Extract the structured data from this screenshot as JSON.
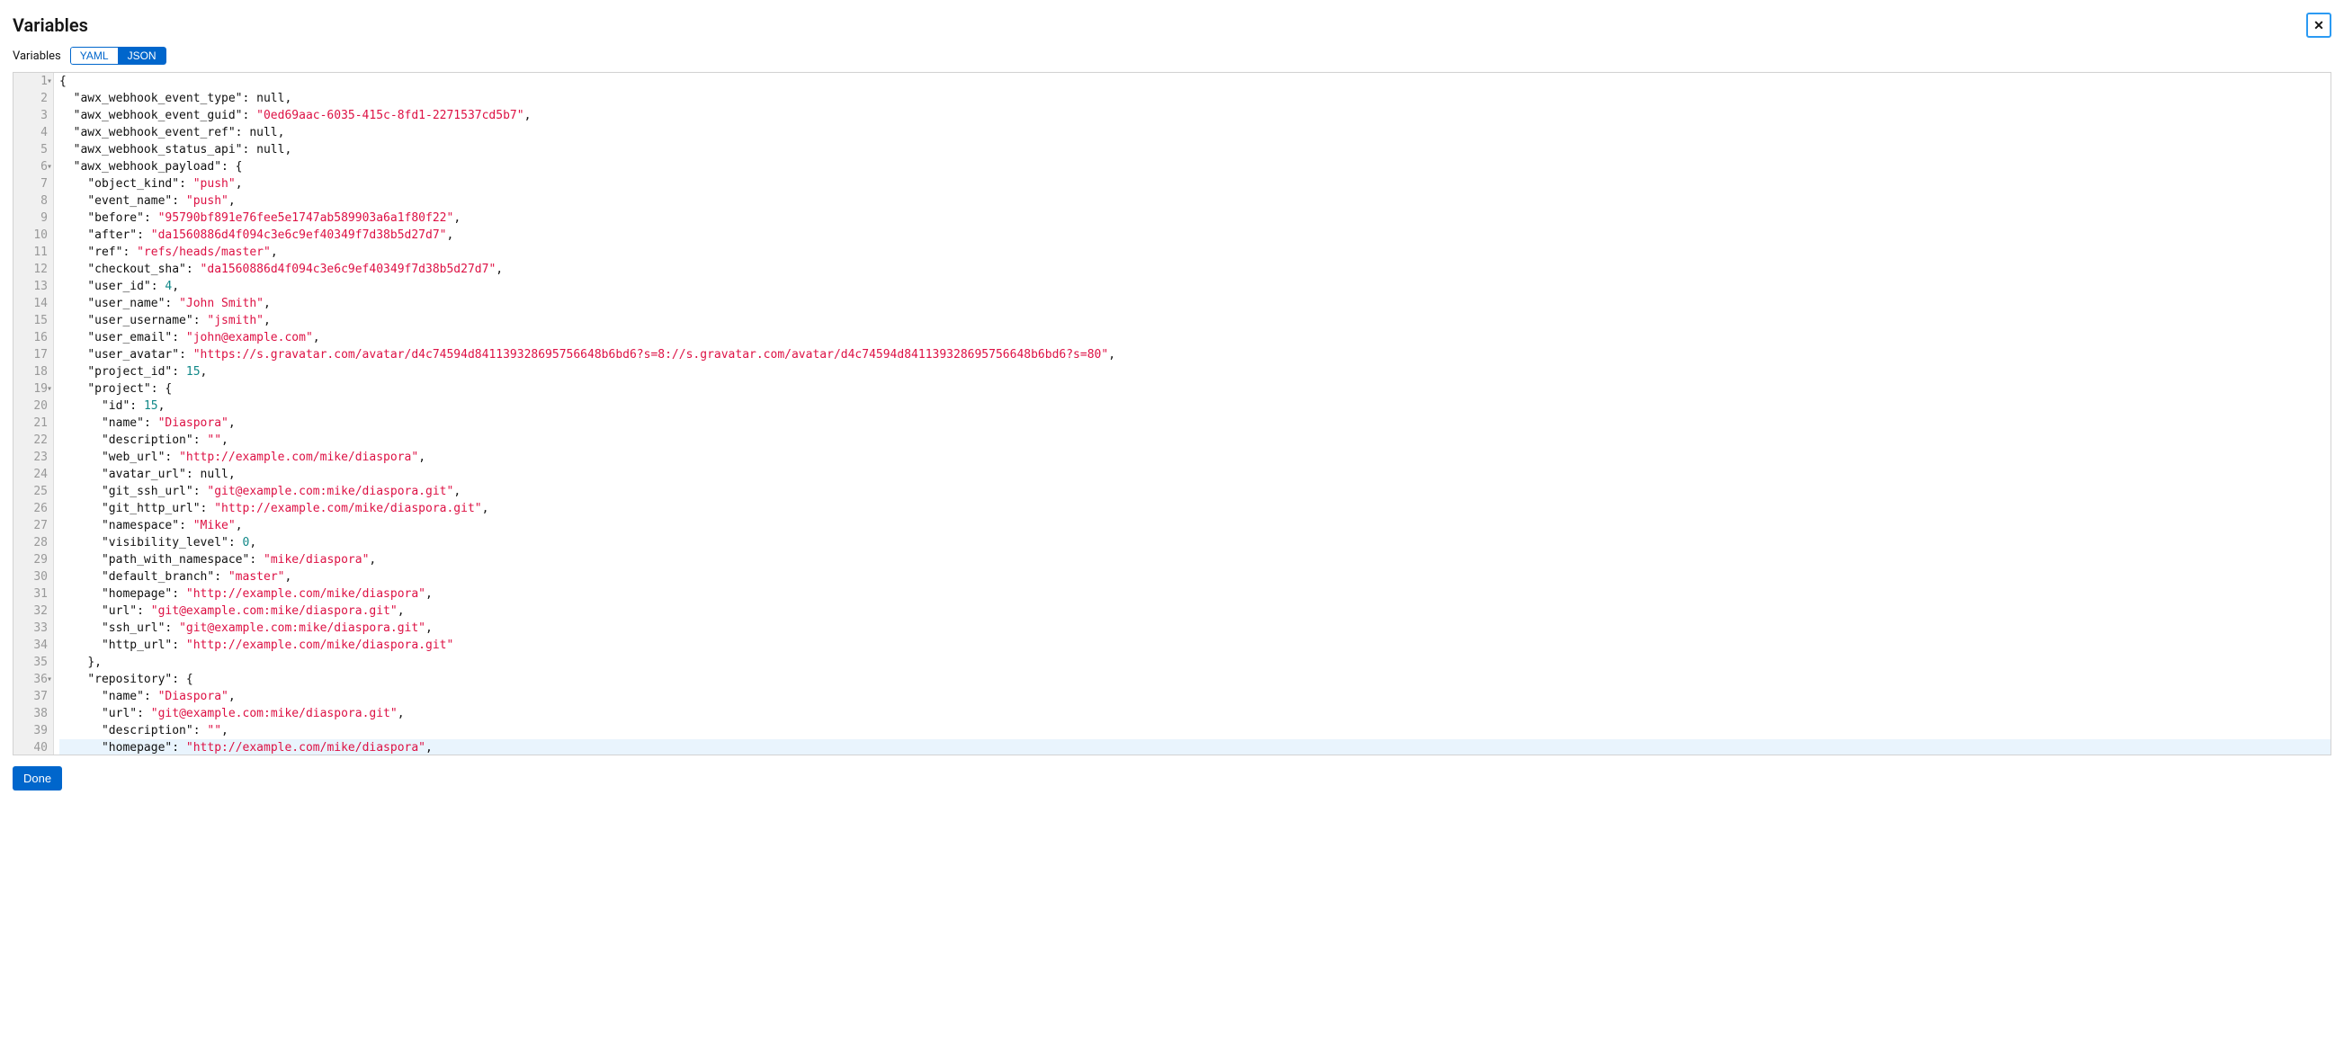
{
  "header": {
    "title": "Variables",
    "close_symbol": "✕"
  },
  "controls": {
    "label": "Variables",
    "toggle": {
      "yaml": "YAML",
      "json": "JSON"
    }
  },
  "footer": {
    "done": "Done"
  },
  "fold_lines": [
    1,
    6,
    19,
    36
  ],
  "code_lines": [
    [
      {
        "t": "punct",
        "v": "{"
      }
    ],
    [
      {
        "t": "ind",
        "v": "  "
      },
      {
        "t": "key",
        "v": "\"awx_webhook_event_type\""
      },
      {
        "t": "punct",
        "v": ": "
      },
      {
        "t": "null",
        "v": "null"
      },
      {
        "t": "punct",
        "v": ","
      }
    ],
    [
      {
        "t": "ind",
        "v": "  "
      },
      {
        "t": "key",
        "v": "\"awx_webhook_event_guid\""
      },
      {
        "t": "punct",
        "v": ": "
      },
      {
        "t": "str",
        "v": "\"0ed69aac-6035-415c-8fd1-2271537cd5b7\""
      },
      {
        "t": "punct",
        "v": ","
      }
    ],
    [
      {
        "t": "ind",
        "v": "  "
      },
      {
        "t": "key",
        "v": "\"awx_webhook_event_ref\""
      },
      {
        "t": "punct",
        "v": ": "
      },
      {
        "t": "null",
        "v": "null"
      },
      {
        "t": "punct",
        "v": ","
      }
    ],
    [
      {
        "t": "ind",
        "v": "  "
      },
      {
        "t": "key",
        "v": "\"awx_webhook_status_api\""
      },
      {
        "t": "punct",
        "v": ": "
      },
      {
        "t": "null",
        "v": "null"
      },
      {
        "t": "punct",
        "v": ","
      }
    ],
    [
      {
        "t": "ind",
        "v": "  "
      },
      {
        "t": "key",
        "v": "\"awx_webhook_payload\""
      },
      {
        "t": "punct",
        "v": ": {"
      }
    ],
    [
      {
        "t": "ind",
        "v": "    "
      },
      {
        "t": "key",
        "v": "\"object_kind\""
      },
      {
        "t": "punct",
        "v": ": "
      },
      {
        "t": "str",
        "v": "\"push\""
      },
      {
        "t": "punct",
        "v": ","
      }
    ],
    [
      {
        "t": "ind",
        "v": "    "
      },
      {
        "t": "key",
        "v": "\"event_name\""
      },
      {
        "t": "punct",
        "v": ": "
      },
      {
        "t": "str",
        "v": "\"push\""
      },
      {
        "t": "punct",
        "v": ","
      }
    ],
    [
      {
        "t": "ind",
        "v": "    "
      },
      {
        "t": "key",
        "v": "\"before\""
      },
      {
        "t": "punct",
        "v": ": "
      },
      {
        "t": "str",
        "v": "\"95790bf891e76fee5e1747ab589903a6a1f80f22\""
      },
      {
        "t": "punct",
        "v": ","
      }
    ],
    [
      {
        "t": "ind",
        "v": "    "
      },
      {
        "t": "key",
        "v": "\"after\""
      },
      {
        "t": "punct",
        "v": ": "
      },
      {
        "t": "str",
        "v": "\"da1560886d4f094c3e6c9ef40349f7d38b5d27d7\""
      },
      {
        "t": "punct",
        "v": ","
      }
    ],
    [
      {
        "t": "ind",
        "v": "    "
      },
      {
        "t": "key",
        "v": "\"ref\""
      },
      {
        "t": "punct",
        "v": ": "
      },
      {
        "t": "str",
        "v": "\"refs/heads/master\""
      },
      {
        "t": "punct",
        "v": ","
      }
    ],
    [
      {
        "t": "ind",
        "v": "    "
      },
      {
        "t": "key",
        "v": "\"checkout_sha\""
      },
      {
        "t": "punct",
        "v": ": "
      },
      {
        "t": "str",
        "v": "\"da1560886d4f094c3e6c9ef40349f7d38b5d27d7\""
      },
      {
        "t": "punct",
        "v": ","
      }
    ],
    [
      {
        "t": "ind",
        "v": "    "
      },
      {
        "t": "key",
        "v": "\"user_id\""
      },
      {
        "t": "punct",
        "v": ": "
      },
      {
        "t": "num",
        "v": "4"
      },
      {
        "t": "punct",
        "v": ","
      }
    ],
    [
      {
        "t": "ind",
        "v": "    "
      },
      {
        "t": "key",
        "v": "\"user_name\""
      },
      {
        "t": "punct",
        "v": ": "
      },
      {
        "t": "str",
        "v": "\"John Smith\""
      },
      {
        "t": "punct",
        "v": ","
      }
    ],
    [
      {
        "t": "ind",
        "v": "    "
      },
      {
        "t": "key",
        "v": "\"user_username\""
      },
      {
        "t": "punct",
        "v": ": "
      },
      {
        "t": "str",
        "v": "\"jsmith\""
      },
      {
        "t": "punct",
        "v": ","
      }
    ],
    [
      {
        "t": "ind",
        "v": "    "
      },
      {
        "t": "key",
        "v": "\"user_email\""
      },
      {
        "t": "punct",
        "v": ": "
      },
      {
        "t": "str",
        "v": "\"john@example.com\""
      },
      {
        "t": "punct",
        "v": ","
      }
    ],
    [
      {
        "t": "ind",
        "v": "    "
      },
      {
        "t": "key",
        "v": "\"user_avatar\""
      },
      {
        "t": "punct",
        "v": ": "
      },
      {
        "t": "str",
        "v": "\"https://s.gravatar.com/avatar/d4c74594d841139328695756648b6bd6?s=8://s.gravatar.com/avatar/d4c74594d841139328695756648b6bd6?s=80\""
      },
      {
        "t": "punct",
        "v": ","
      }
    ],
    [
      {
        "t": "ind",
        "v": "    "
      },
      {
        "t": "key",
        "v": "\"project_id\""
      },
      {
        "t": "punct",
        "v": ": "
      },
      {
        "t": "num",
        "v": "15"
      },
      {
        "t": "punct",
        "v": ","
      }
    ],
    [
      {
        "t": "ind",
        "v": "    "
      },
      {
        "t": "key",
        "v": "\"project\""
      },
      {
        "t": "punct",
        "v": ": {"
      }
    ],
    [
      {
        "t": "ind",
        "v": "      "
      },
      {
        "t": "key",
        "v": "\"id\""
      },
      {
        "t": "punct",
        "v": ": "
      },
      {
        "t": "num",
        "v": "15"
      },
      {
        "t": "punct",
        "v": ","
      }
    ],
    [
      {
        "t": "ind",
        "v": "      "
      },
      {
        "t": "key",
        "v": "\"name\""
      },
      {
        "t": "punct",
        "v": ": "
      },
      {
        "t": "str",
        "v": "\"Diaspora\""
      },
      {
        "t": "punct",
        "v": ","
      }
    ],
    [
      {
        "t": "ind",
        "v": "      "
      },
      {
        "t": "key",
        "v": "\"description\""
      },
      {
        "t": "punct",
        "v": ": "
      },
      {
        "t": "str",
        "v": "\"\""
      },
      {
        "t": "punct",
        "v": ","
      }
    ],
    [
      {
        "t": "ind",
        "v": "      "
      },
      {
        "t": "key",
        "v": "\"web_url\""
      },
      {
        "t": "punct",
        "v": ": "
      },
      {
        "t": "str",
        "v": "\"http://example.com/mike/diaspora\""
      },
      {
        "t": "punct",
        "v": ","
      }
    ],
    [
      {
        "t": "ind",
        "v": "      "
      },
      {
        "t": "key",
        "v": "\"avatar_url\""
      },
      {
        "t": "punct",
        "v": ": "
      },
      {
        "t": "null",
        "v": "null"
      },
      {
        "t": "punct",
        "v": ","
      }
    ],
    [
      {
        "t": "ind",
        "v": "      "
      },
      {
        "t": "key",
        "v": "\"git_ssh_url\""
      },
      {
        "t": "punct",
        "v": ": "
      },
      {
        "t": "str",
        "v": "\"git@example.com:mike/diaspora.git\""
      },
      {
        "t": "punct",
        "v": ","
      }
    ],
    [
      {
        "t": "ind",
        "v": "      "
      },
      {
        "t": "key",
        "v": "\"git_http_url\""
      },
      {
        "t": "punct",
        "v": ": "
      },
      {
        "t": "str",
        "v": "\"http://example.com/mike/diaspora.git\""
      },
      {
        "t": "punct",
        "v": ","
      }
    ],
    [
      {
        "t": "ind",
        "v": "      "
      },
      {
        "t": "key",
        "v": "\"namespace\""
      },
      {
        "t": "punct",
        "v": ": "
      },
      {
        "t": "str",
        "v": "\"Mike\""
      },
      {
        "t": "punct",
        "v": ","
      }
    ],
    [
      {
        "t": "ind",
        "v": "      "
      },
      {
        "t": "key",
        "v": "\"visibility_level\""
      },
      {
        "t": "punct",
        "v": ": "
      },
      {
        "t": "num",
        "v": "0"
      },
      {
        "t": "punct",
        "v": ","
      }
    ],
    [
      {
        "t": "ind",
        "v": "      "
      },
      {
        "t": "key",
        "v": "\"path_with_namespace\""
      },
      {
        "t": "punct",
        "v": ": "
      },
      {
        "t": "str",
        "v": "\"mike/diaspora\""
      },
      {
        "t": "punct",
        "v": ","
      }
    ],
    [
      {
        "t": "ind",
        "v": "      "
      },
      {
        "t": "key",
        "v": "\"default_branch\""
      },
      {
        "t": "punct",
        "v": ": "
      },
      {
        "t": "str",
        "v": "\"master\""
      },
      {
        "t": "punct",
        "v": ","
      }
    ],
    [
      {
        "t": "ind",
        "v": "      "
      },
      {
        "t": "key",
        "v": "\"homepage\""
      },
      {
        "t": "punct",
        "v": ": "
      },
      {
        "t": "str",
        "v": "\"http://example.com/mike/diaspora\""
      },
      {
        "t": "punct",
        "v": ","
      }
    ],
    [
      {
        "t": "ind",
        "v": "      "
      },
      {
        "t": "key",
        "v": "\"url\""
      },
      {
        "t": "punct",
        "v": ": "
      },
      {
        "t": "str",
        "v": "\"git@example.com:mike/diaspora.git\""
      },
      {
        "t": "punct",
        "v": ","
      }
    ],
    [
      {
        "t": "ind",
        "v": "      "
      },
      {
        "t": "key",
        "v": "\"ssh_url\""
      },
      {
        "t": "punct",
        "v": ": "
      },
      {
        "t": "str",
        "v": "\"git@example.com:mike/diaspora.git\""
      },
      {
        "t": "punct",
        "v": ","
      }
    ],
    [
      {
        "t": "ind",
        "v": "      "
      },
      {
        "t": "key",
        "v": "\"http_url\""
      },
      {
        "t": "punct",
        "v": ": "
      },
      {
        "t": "str",
        "v": "\"http://example.com/mike/diaspora.git\""
      }
    ],
    [
      {
        "t": "ind",
        "v": "    "
      },
      {
        "t": "punct",
        "v": "},"
      }
    ],
    [
      {
        "t": "ind",
        "v": "    "
      },
      {
        "t": "key",
        "v": "\"repository\""
      },
      {
        "t": "punct",
        "v": ": {"
      }
    ],
    [
      {
        "t": "ind",
        "v": "      "
      },
      {
        "t": "key",
        "v": "\"name\""
      },
      {
        "t": "punct",
        "v": ": "
      },
      {
        "t": "str",
        "v": "\"Diaspora\""
      },
      {
        "t": "punct",
        "v": ","
      }
    ],
    [
      {
        "t": "ind",
        "v": "      "
      },
      {
        "t": "key",
        "v": "\"url\""
      },
      {
        "t": "punct",
        "v": ": "
      },
      {
        "t": "str",
        "v": "\"git@example.com:mike/diaspora.git\""
      },
      {
        "t": "punct",
        "v": ","
      }
    ],
    [
      {
        "t": "ind",
        "v": "      "
      },
      {
        "t": "key",
        "v": "\"description\""
      },
      {
        "t": "punct",
        "v": ": "
      },
      {
        "t": "str",
        "v": "\"\""
      },
      {
        "t": "punct",
        "v": ","
      }
    ],
    [
      {
        "t": "ind",
        "v": "      "
      },
      {
        "t": "key",
        "v": "\"homepage\""
      },
      {
        "t": "punct",
        "v": ": "
      },
      {
        "t": "str",
        "v": "\"http://example.com/mike/diaspora\""
      },
      {
        "t": "punct",
        "v": ","
      }
    ]
  ]
}
